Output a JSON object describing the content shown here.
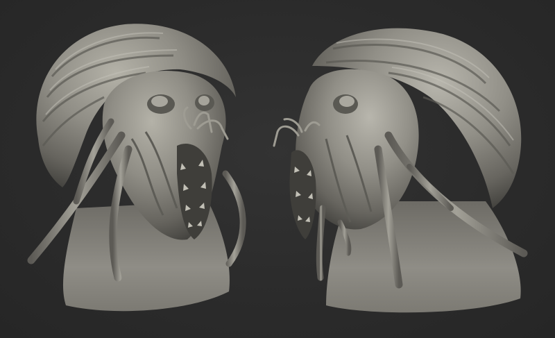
{
  "scene": {
    "description_visible_text": "",
    "background_color": "#2c2c2c",
    "material_color": "#8e8c84",
    "highlight_color": "#b9b7ae",
    "shadow_color": "#3d3c38"
  },
  "sculpts": [
    {
      "view": "front-three-quarter"
    },
    {
      "view": "side-three-quarter"
    }
  ]
}
